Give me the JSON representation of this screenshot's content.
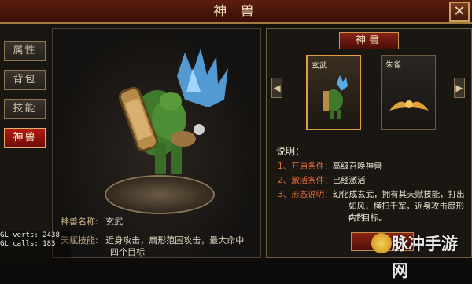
{
  "window": {
    "title": "神 兽",
    "close": "✕"
  },
  "sidebar": {
    "items": [
      {
        "label": "属性",
        "active": false
      },
      {
        "label": "背包",
        "active": false
      },
      {
        "label": "技能",
        "active": false
      },
      {
        "label": "神兽",
        "active": true
      }
    ]
  },
  "beast": {
    "name_label": "神兽名称:",
    "name": "玄武",
    "talent_label": "天赋技能:",
    "talent_line1": "近身攻击，扇形范围攻击，最大命中",
    "talent_line2": "四个目标"
  },
  "panel": {
    "header": "神兽",
    "cards": [
      {
        "name": "玄武",
        "selected": true
      },
      {
        "name": "朱雀",
        "selected": false
      }
    ],
    "desc_title": "说明：",
    "desc": [
      {
        "num": "1、",
        "label": "开启条件：",
        "value": "高级召唤神兽"
      },
      {
        "num": "2、",
        "label": "激活条件：",
        "value": "已经激活"
      },
      {
        "num": "3、",
        "label": "形态说明：",
        "value": "幻化成玄武，拥有其天赋技能，打出",
        "value2": "如风，横扫千军，近身攻击扇形内的",
        "value3": "4个目标。"
      }
    ],
    "button": "幻化"
  },
  "debug": {
    "line1": "GL verts:    2438",
    "line2": "GL calls:     183"
  },
  "watermark": "脉冲手游网",
  "colors": {
    "accent": "#b21b12",
    "gold": "#c9a35c",
    "bg": "#15120f"
  }
}
